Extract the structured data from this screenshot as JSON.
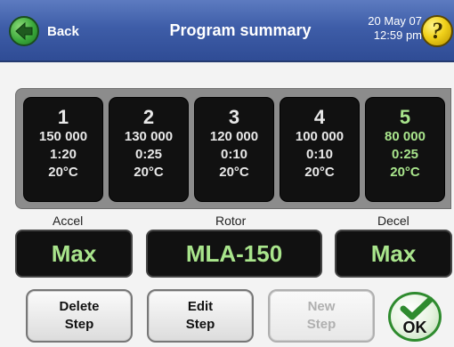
{
  "header": {
    "back_label": "Back",
    "title": "Program summary",
    "date": "20 May 07",
    "time": "12:59 pm",
    "help_symbol": "?"
  },
  "steps": [
    {
      "number": "1",
      "speed": "150 000",
      "time": "1:20",
      "temp": "20°C"
    },
    {
      "number": "2",
      "speed": "130 000",
      "time": "0:25",
      "temp": "20°C"
    },
    {
      "number": "3",
      "speed": "120 000",
      "time": "0:10",
      "temp": "20°C"
    },
    {
      "number": "4",
      "speed": "100 000",
      "time": "0:10",
      "temp": "20°C"
    },
    {
      "number": "5",
      "speed": "80 000",
      "time": "0:25",
      "temp": "20°C"
    }
  ],
  "active_step": 5,
  "settings": {
    "accel_label": "Accel",
    "accel_value": "Max",
    "rotor_label": "Rotor",
    "rotor_value": "MLA-150",
    "decel_label": "Decel",
    "decel_value": "Max"
  },
  "buttons": {
    "delete_line1": "Delete",
    "delete_line2": "Step",
    "edit_line1": "Edit",
    "edit_line2": "Step",
    "new_line1": "New",
    "new_line2": "Step",
    "ok": "OK"
  },
  "colors": {
    "header_blue": "#3e5da8",
    "lcd_green": "#a9e58c",
    "back_green": "#3aa83a",
    "help_yellow": "#f1d11a"
  },
  "icons": {
    "back": "left-arrow-icon",
    "help": "question-mark-icon",
    "ok": "checkmark-icon"
  }
}
